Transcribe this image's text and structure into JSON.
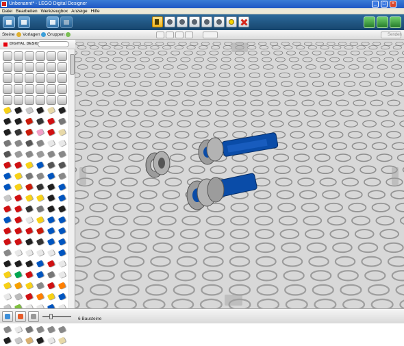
{
  "window": {
    "title": "Unbenannt* - LEGO Digital Designer"
  },
  "menu": [
    "Datei",
    "Bearbeiten",
    "Werkzeugbox",
    "Anzeige",
    "Hilfe"
  ],
  "toolbar": {
    "tools": [
      "select",
      "clone",
      "hinge",
      "flex",
      "paint",
      "hide",
      "minifigure",
      "delete"
    ],
    "selected_tool": "select"
  },
  "tabs": {
    "bricks": "Steine",
    "templates": "Vorlagen",
    "groups": "Gruppen",
    "send": "Senden"
  },
  "palette": {
    "brand": "DIGITAL DESIGNER",
    "search_placeholder": "",
    "brick_colors": [
      "#999999",
      "#999999",
      "#999999",
      "#999999",
      "#999999",
      "#999999",
      "#999999",
      "#999999",
      "#999999",
      "#999999",
      "#999999",
      "#999999",
      "#999999",
      "#999999",
      "#999999",
      "#999999",
      "#999999",
      "#999999",
      "#999999",
      "#999999",
      "#999999",
      "#999999",
      "#999999",
      "#999999",
      "#999999",
      "#999999",
      "#999999",
      "#999999",
      "#999999",
      "#999999",
      "#f7d117",
      "#1f1f1f",
      "#c8c8c8",
      "#1f1f1f",
      "#e8d9a8",
      "#222222",
      "#1f1f1f",
      "#1f1f1f",
      "#c91a09",
      "#333333",
      "#d01012",
      "#777777",
      "#1f1f1f",
      "#333333",
      "#c91a09",
      "#f0a0c8",
      "#d01012",
      "#e8d9a8",
      "#777777",
      "#888888",
      "#555555",
      "#888888",
      "#e8e8e8",
      "#e8e8e8",
      "#555555",
      "#999999",
      "#888888",
      "#999999",
      "#888888",
      "#888888",
      "#d01012",
      "#d01012",
      "#f7d117",
      "#0055bf",
      "#555555",
      "#555555",
      "#0055bf",
      "#f7d117",
      "#777777",
      "#888888",
      "#0055bf",
      "#888888",
      "#0055bf",
      "#f7d117",
      "#c91a09",
      "#333333",
      "#1f1f1f",
      "#0055bf",
      "#c8c8c8",
      "#d01012",
      "#f7d117",
      "#f7d117",
      "#1f1f1f",
      "#0055bf",
      "#d01012",
      "#d01012",
      "#333333",
      "#777777",
      "#1f1f1f",
      "#1f1f1f",
      "#0055bf",
      "#d01012",
      "#e8e8e8",
      "#f7d117",
      "#0055bf",
      "#0055bf",
      "#d01012",
      "#d01012",
      "#d01012",
      "#c91a09",
      "#0055bf",
      "#0055bf",
      "#d01012",
      "#d01012",
      "#1f1f1f",
      "#333333",
      "#0055bf",
      "#0055bf",
      "#888888",
      "#e8e8e8",
      "#e8e8e8",
      "#e8e8e8",
      "#e8e8e8",
      "#0055bf",
      "#1f1f1f",
      "#1f1f1f",
      "#1f1f1f",
      "#0055bf",
      "#d01012",
      "#e8e8e8",
      "#f7d117",
      "#00a650",
      "#d01012",
      "#0055bf",
      "#777777",
      "#e8e8e8",
      "#f7d117",
      "#f7a000",
      "#f7d117",
      "#888888",
      "#d01012",
      "#ff7f00",
      "#e8e8e8",
      "#bbbbbb",
      "#d01012",
      "#ff7f00",
      "#f7d117",
      "#0055bf",
      "#c8c8c8",
      "#7fbf3f",
      "#e8e8e8",
      "#e8e8e8",
      "#0055bf",
      "#e8e8e8",
      "#d01012",
      "#0055bf",
      "#1f1f1f",
      "#e8e8e8",
      "#ff7f00",
      "#333333",
      "#888888",
      "#e8e8e8",
      "#777777",
      "#888888",
      "#888888",
      "#888888",
      "#1f1f1f",
      "#c8c8c8",
      "#d8b070",
      "#1f1f1f",
      "#e8e8e8",
      "#e8d9a8"
    ]
  },
  "scene": {
    "parts": [
      {
        "type": "technic-bush",
        "color": "#9c9c9c"
      },
      {
        "type": "technic-bush-with-axle",
        "color": "#9c9c9c",
        "axle_color": "#0a4ca8"
      },
      {
        "type": "technic-bush-with-axle",
        "color": "#9c9c9c",
        "axle_color": "#0a4ca8"
      }
    ]
  },
  "status": {
    "text": "6 Bausteine"
  },
  "colors": {
    "toolbar_bg": "#1f5384",
    "baseplate": "#c8c8c8",
    "technic_blue": "#0a4ca8"
  }
}
